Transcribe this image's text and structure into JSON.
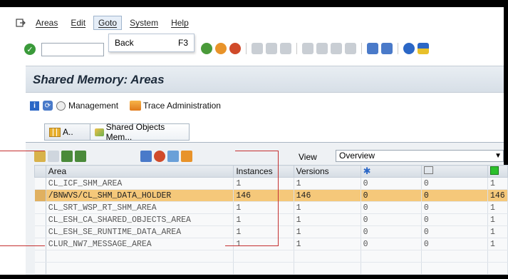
{
  "menu": {
    "items": [
      "Areas",
      "Edit",
      "Goto",
      "System",
      "Help"
    ]
  },
  "dropdown": {
    "label": "Back",
    "shortcut": "F3"
  },
  "page": {
    "title": "Shared Memory: Areas"
  },
  "appbar": {
    "management": "Management",
    "trace": "Trace Administration"
  },
  "tabs": [
    {
      "label": "A.."
    },
    {
      "label": "Shared Objects Mem..."
    }
  ],
  "view": {
    "label": "View",
    "value": "Overview"
  },
  "table": {
    "columns": [
      "Area",
      "Instances",
      "Versions",
      "",
      "",
      ""
    ],
    "rows": [
      [
        "CL_ICF_SHM_AREA",
        "1",
        "1",
        "0",
        "0",
        "1"
      ],
      [
        "/BNWVS/CL_SHM_DATA_HOLDER",
        "146",
        "146",
        "0",
        "0",
        "146"
      ],
      [
        "CL_SRT_WSP_RT_SHM_AREA",
        "1",
        "1",
        "0",
        "0",
        "1"
      ],
      [
        "CL_ESH_CA_SHARED_OBJECTS_AREA",
        "1",
        "1",
        "0",
        "0",
        "1"
      ],
      [
        "CL_ESH_SE_RUNTIME_DATA_AREA",
        "1",
        "1",
        "0",
        "0",
        "1"
      ],
      [
        "CLUR_NW7_MESSAGE_AREA",
        "1",
        "1",
        "0",
        "0",
        "1"
      ]
    ],
    "highlighted_row": 1
  },
  "colors": {
    "highlight": "#f5c87a",
    "accent_red": "#c43030",
    "title_text": "#1c2a3a"
  }
}
